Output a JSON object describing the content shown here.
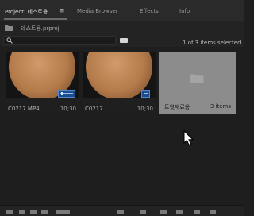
{
  "tabs": {
    "project": "Project: 테스트용",
    "media_browser": "Media Browser",
    "effects": "Effects",
    "info": "Info"
  },
  "project": {
    "filename": "테스트용.prproj"
  },
  "toolbar": {
    "selection": "1 of 3 items selected"
  },
  "items": [
    {
      "name": "C0217.MP4",
      "duration": "10;30",
      "kind": "clip"
    },
    {
      "name": "C0217",
      "duration": "10;30",
      "kind": "sequence"
    },
    {
      "name": "트윗재료용",
      "count": "3 items",
      "kind": "bin",
      "selected": true
    }
  ],
  "colors": {
    "panel": "#1e1e1e",
    "selected_item": "#8c8c8c",
    "badge": "#1b4c8c"
  }
}
